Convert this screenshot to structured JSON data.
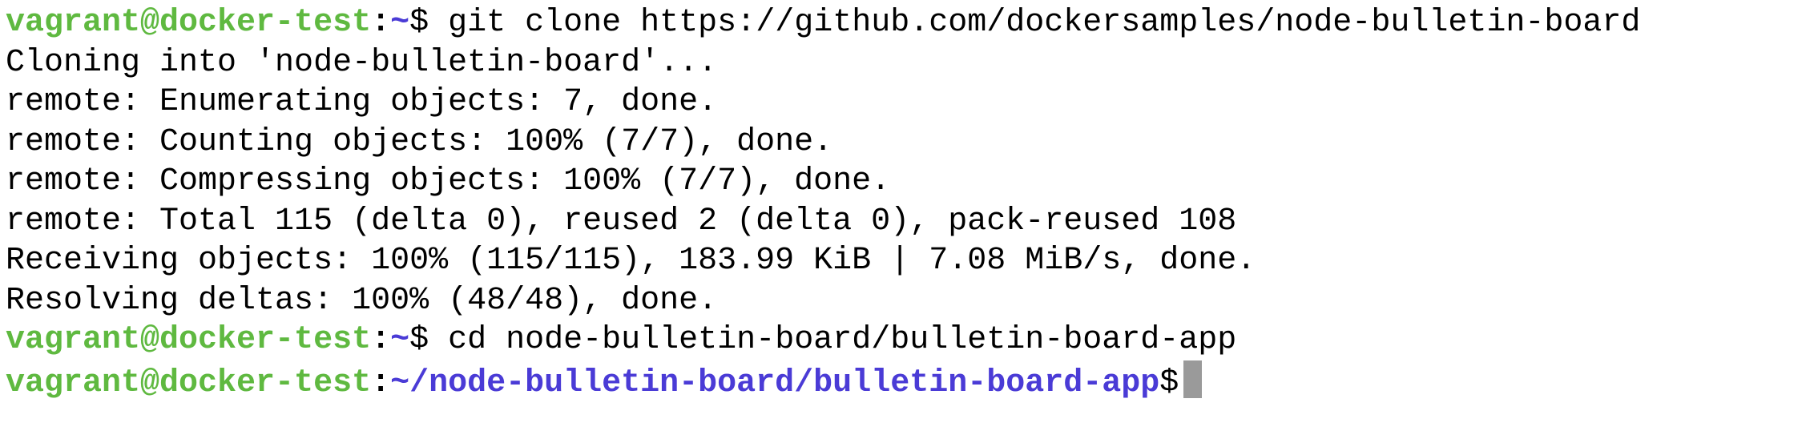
{
  "terminal": {
    "colors": {
      "user": "#5fb940",
      "path": "#4a3bd6",
      "cursor": "#9a9a9a"
    },
    "prompt_user": "vagrant@docker-test",
    "lines": [
      {
        "type": "prompt",
        "path": "~",
        "command": "git clone https://github.com/dockersamples/node-bulletin-board"
      },
      {
        "type": "output",
        "text": "Cloning into 'node-bulletin-board'..."
      },
      {
        "type": "output",
        "text": "remote: Enumerating objects: 7, done."
      },
      {
        "type": "output",
        "text": "remote: Counting objects: 100% (7/7), done."
      },
      {
        "type": "output",
        "text": "remote: Compressing objects: 100% (7/7), done."
      },
      {
        "type": "output",
        "text": "remote: Total 115 (delta 0), reused 2 (delta 0), pack-reused 108"
      },
      {
        "type": "output",
        "text": "Receiving objects: 100% (115/115), 183.99 KiB | 7.08 MiB/s, done."
      },
      {
        "type": "output",
        "text": "Resolving deltas: 100% (48/48), done."
      },
      {
        "type": "prompt",
        "path": "~",
        "command": "cd node-bulletin-board/bulletin-board-app"
      },
      {
        "type": "prompt",
        "path": "~/node-bulletin-board/bulletin-board-app",
        "command": ""
      }
    ]
  }
}
